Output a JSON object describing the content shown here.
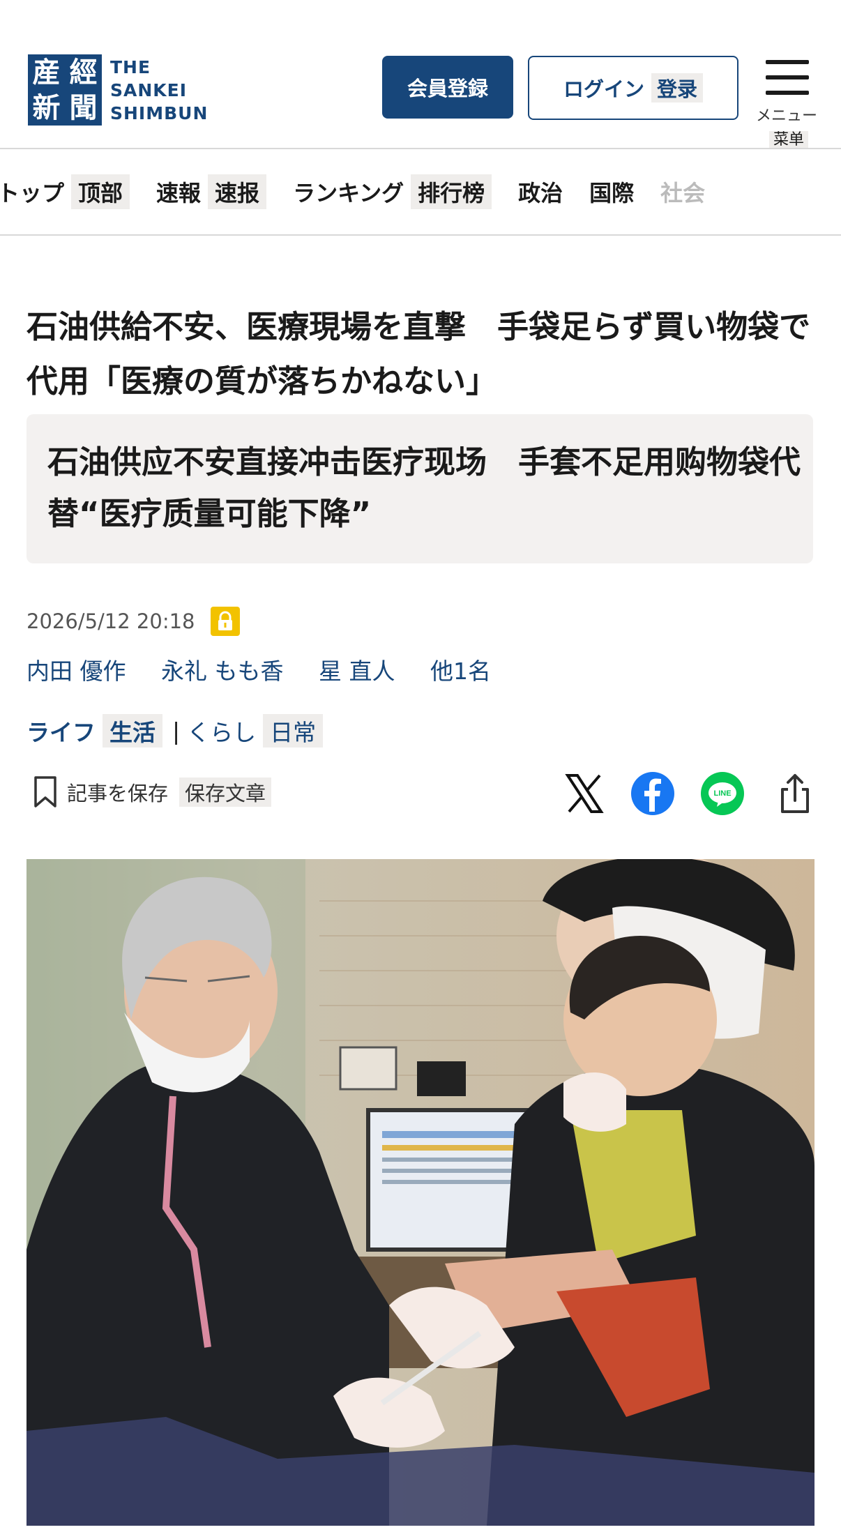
{
  "header": {
    "logo": {
      "mark_chars": [
        "産",
        "經",
        "新",
        "聞"
      ],
      "lines": [
        "THE",
        "SANKEI",
        "SHIMBUN"
      ]
    },
    "register_button": "会員登録",
    "login_button": "ログイン",
    "login_translation": "登录",
    "menu_label": "メニュー",
    "menu_translation": "菜单"
  },
  "nav": {
    "items": [
      {
        "label": "トップ",
        "translation": "顶部"
      },
      {
        "label": "速報",
        "translation": "速报"
      },
      {
        "label": "ランキング",
        "translation": "排行榜"
      },
      {
        "label": "政治",
        "translation": ""
      },
      {
        "label": "国際",
        "translation": ""
      },
      {
        "label": "社会",
        "translation": ""
      }
    ]
  },
  "article": {
    "title": "石油供給不安、医療現場を直撃　手袋足らず買い物袋で代用「医療の質が落ちかねない」",
    "title_translation": "石油供应不安直接冲击医疗现场　手套不足用购物袋代替“医疗质量可能下降”",
    "date": "2026/5/12 20:18",
    "authors": [
      "内田 優作",
      "永礼 もも香",
      "星 直人",
      "他1名"
    ],
    "category": "ライフ",
    "category_translation": "生活",
    "subcategory": "くらし",
    "subcategory_translation": "日常",
    "save_label": "記事を保存",
    "save_translation": "保存文章"
  },
  "share": {
    "icons": [
      "x-icon",
      "facebook-icon",
      "line-icon",
      "share-icon"
    ],
    "line_text": "LINE"
  },
  "colors": {
    "brand_navy": "#17467a",
    "lock_yellow": "#f2c200",
    "facebook_blue": "#1877f2",
    "line_green": "#06c755",
    "translation_bg": "#efedeb"
  }
}
